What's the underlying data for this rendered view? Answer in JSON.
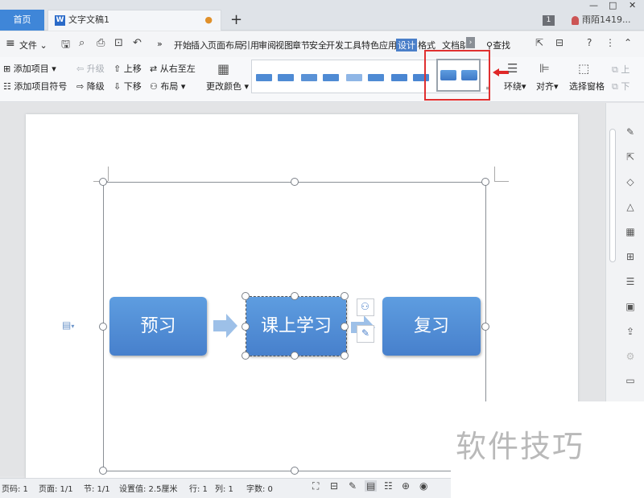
{
  "titlebar": {
    "home_tab": "首页",
    "doc_icon": "W",
    "doc_tab": "文字文稿1",
    "unsaved_dot": "●",
    "new_tab": "+",
    "page_badge": "1",
    "user": "雨陌1419...",
    "minimize": "—",
    "maximize": "□",
    "close": "✕"
  },
  "menubar": {
    "menu_icon": "≡",
    "file": "文件",
    "more": "»",
    "tabs": [
      "开始",
      "插入",
      "页面布局",
      "引用",
      "审阅",
      "视图",
      "章节",
      "安全",
      "开发工具",
      "特色应用",
      "设计",
      "格式",
      "文档助"
    ],
    "active_tab": "设计",
    "search": "查找"
  },
  "toolbar": {
    "add_item": "添加项目",
    "add_bullet": "添加项目符号",
    "promote": "升级",
    "demote": "降级",
    "move_up": "上移",
    "move_down": "下移",
    "right_to_left": "从右至左",
    "layout": "布局",
    "change_color": "更改颜色",
    "wrap": "环绕",
    "align": "对齐",
    "selection_pane": "选择窗格",
    "up_short": "上",
    "down_short": "下"
  },
  "style_gallery": {
    "colors": [
      "#4f8bd4",
      "#4f8bd4",
      "#5a92d6",
      "#4f8bd4",
      "#8fb6e6",
      "#4f8bd4",
      "#4a86d2"
    ]
  },
  "smartart": {
    "nodes": [
      "预习",
      "课上学习",
      "复习"
    ]
  },
  "statusbar": {
    "page_no": "页码: 1",
    "pages": "页面: 1/1",
    "section": "节: 1/1",
    "setting": "设置值: 2.5厘米",
    "row": "行: 1",
    "col": "列: 1",
    "words": "字数: 0"
  },
  "watermark": "软件技巧"
}
